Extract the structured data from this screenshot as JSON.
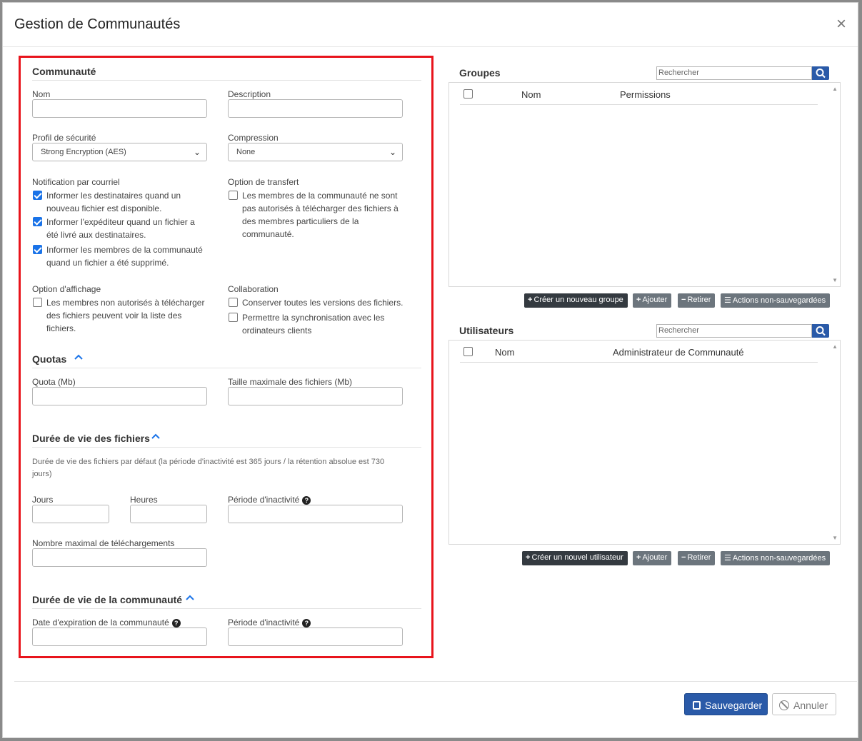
{
  "modal": {
    "title": "Gestion de Communautés",
    "close": "×"
  },
  "communaute": {
    "title": "Communauté",
    "nom_label": "Nom",
    "description_label": "Description",
    "profil_label": "Profil de sécurité",
    "profil_value": "Strong Encryption (AES)",
    "compression_label": "Compression",
    "compression_value": "None",
    "notif_label": "Notification par courriel",
    "notif_options": [
      {
        "lines": [
          "Informer les destinataires quand un",
          "nouveau fichier est disponible."
        ],
        "checked": true
      },
      {
        "lines": [
          "Informer l'expéditeur quand un fichier a",
          "été livré aux destinataires."
        ],
        "checked": true
      },
      {
        "lines": [
          "Informer les membres de la communauté",
          "quand un fichier a été supprimé."
        ],
        "checked": true
      }
    ],
    "transfert_label": "Option de transfert",
    "transfert_lines": [
      "Les membres de la communauté ne sont",
      "pas autorisés à télécharger des fichiers à",
      "des membres particuliers de la",
      "communauté."
    ],
    "affichage_label": "Option d'affichage",
    "affichage_lines": [
      "Les membres non autorisés à télécharger",
      "des fichiers peuvent voir la liste des",
      "fichiers."
    ],
    "collab_label": "Collaboration",
    "collab_option1": "Conserver toutes les versions des fichiers.",
    "collab_option2_lines": [
      "Permettre la synchronisation avec les",
      "ordinateurs clients"
    ]
  },
  "quotas": {
    "title": "Quotas",
    "quota_label": "Quota (Mb)",
    "taille_label": "Taille maximale des fichiers (Mb)"
  },
  "duree_fichiers": {
    "title": "Durée de vie des fichiers",
    "desc_lines": [
      "Durée de vie des fichiers par défaut (la période d'inactivité est 365 jours / la rétention absolue est 730",
      "jours)"
    ],
    "jours_label": "Jours",
    "heures_label": "Heures",
    "inactivite_label": "Période d'inactivité",
    "max_dl_label": "Nombre maximal de téléchargements"
  },
  "duree_communaute": {
    "title": "Durée de vie de la communauté",
    "expiration_label": "Date d'expiration de la communauté",
    "inactivite_label": "Période d'inactivité"
  },
  "groupes": {
    "title": "Groupes",
    "search_placeholder": "Rechercher",
    "col_nom": "Nom",
    "col_permissions": "Permissions",
    "btn_create": "Créer un nouveau groupe",
    "btn_add": "Ajouter",
    "btn_remove": "Retirer",
    "btn_actions": "Actions non-sauvegardées"
  },
  "utilisateurs": {
    "title": "Utilisateurs",
    "search_placeholder": "Rechercher",
    "col_nom": "Nom",
    "col_admin": "Administrateur de Communauté",
    "btn_create": "Créer un nouvel utilisateur",
    "btn_add": "Ajouter",
    "btn_remove": "Retirer",
    "btn_actions": "Actions non-sauvegardées"
  },
  "footer": {
    "save": "Sauvegarder",
    "cancel": "Annuler"
  },
  "colors": {
    "primary": "#2a5aa8",
    "highlight_border": "#e8141c",
    "checkbox": "#1a73e8"
  }
}
